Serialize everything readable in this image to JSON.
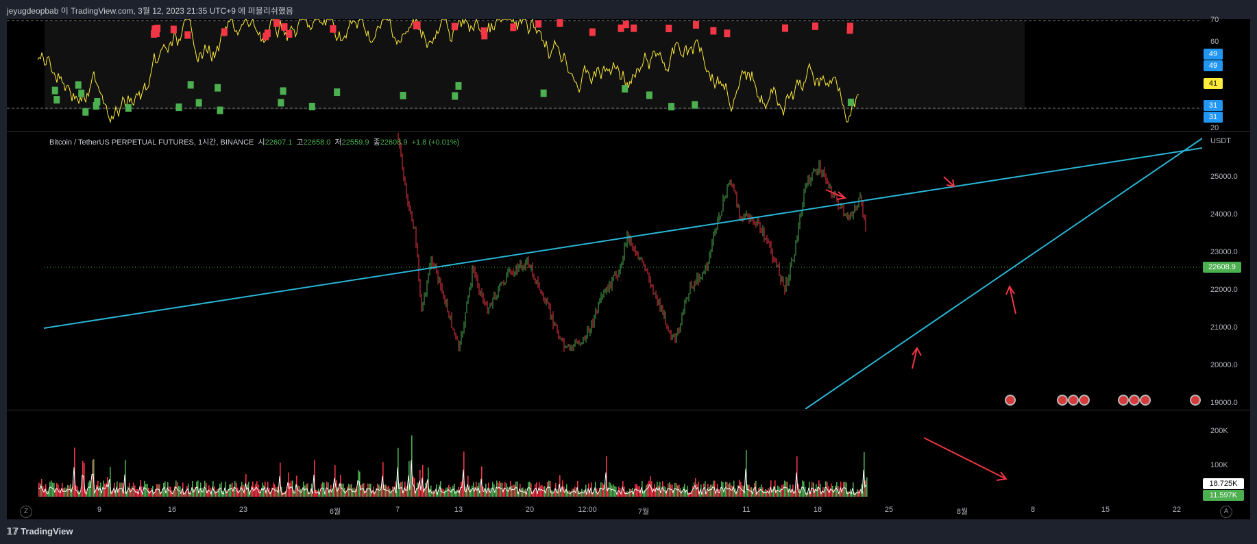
{
  "header": {
    "attribution": "jeyugdeopbab 이 TradingView.com, 3월 12, 2023 21:35 UTC+9 에 퍼블리쉬했음"
  },
  "legend": {
    "symbol": "Bitcoin / TetherUS PERPETUAL FUTURES, 1시간, BINANCE",
    "o_label": "시",
    "o_val": "22607.1",
    "h_label": "고",
    "h_val": "22658.0",
    "l_label": "저",
    "l_val": "22559.9",
    "c_label": "종",
    "c_val": "22608.9",
    "change": "+1.8 (+0.01%)"
  },
  "price_axis": {
    "currency": "USDT",
    "ticks": [
      "25000.0",
      "24000.0",
      "23000.0",
      "22000.0",
      "21000.0",
      "20000.0",
      "19000.0"
    ],
    "current": "22608.9"
  },
  "osc_axis": {
    "ticks": [
      "70",
      "60",
      "20"
    ],
    "tags": [
      {
        "text": "49",
        "color": "#2196f3"
      },
      {
        "text": "49",
        "color": "#2196f3"
      },
      {
        "text": "41",
        "color": "#ffeb3b"
      },
      {
        "text": "31",
        "color": "#2196f3"
      },
      {
        "text": "31",
        "color": "#2196f3"
      }
    ]
  },
  "vol_axis": {
    "ticks": [
      "200K",
      "100K"
    ],
    "tag1": "18.725K",
    "tag2": "11.597K"
  },
  "time_axis": {
    "ticks": [
      "9",
      "16",
      "23",
      "6월",
      "7",
      "13",
      "20",
      "12:00",
      "7월",
      "11",
      "18",
      "25",
      "8월",
      "8",
      "15",
      "22"
    ],
    "left_btn": "Z",
    "right_btn": "A"
  },
  "footer": {
    "brand": "TradingView"
  },
  "colors": {
    "trendline": "#29b6d6",
    "rsi": "#ffeb3b",
    "arrow": "#f23645",
    "bull": "#4caf50",
    "bear": "#f23645",
    "bg": "#000000"
  },
  "icons": [
    "tv-logo-icon",
    "event-flag-icon",
    "arrow-annotation-icon"
  ]
}
